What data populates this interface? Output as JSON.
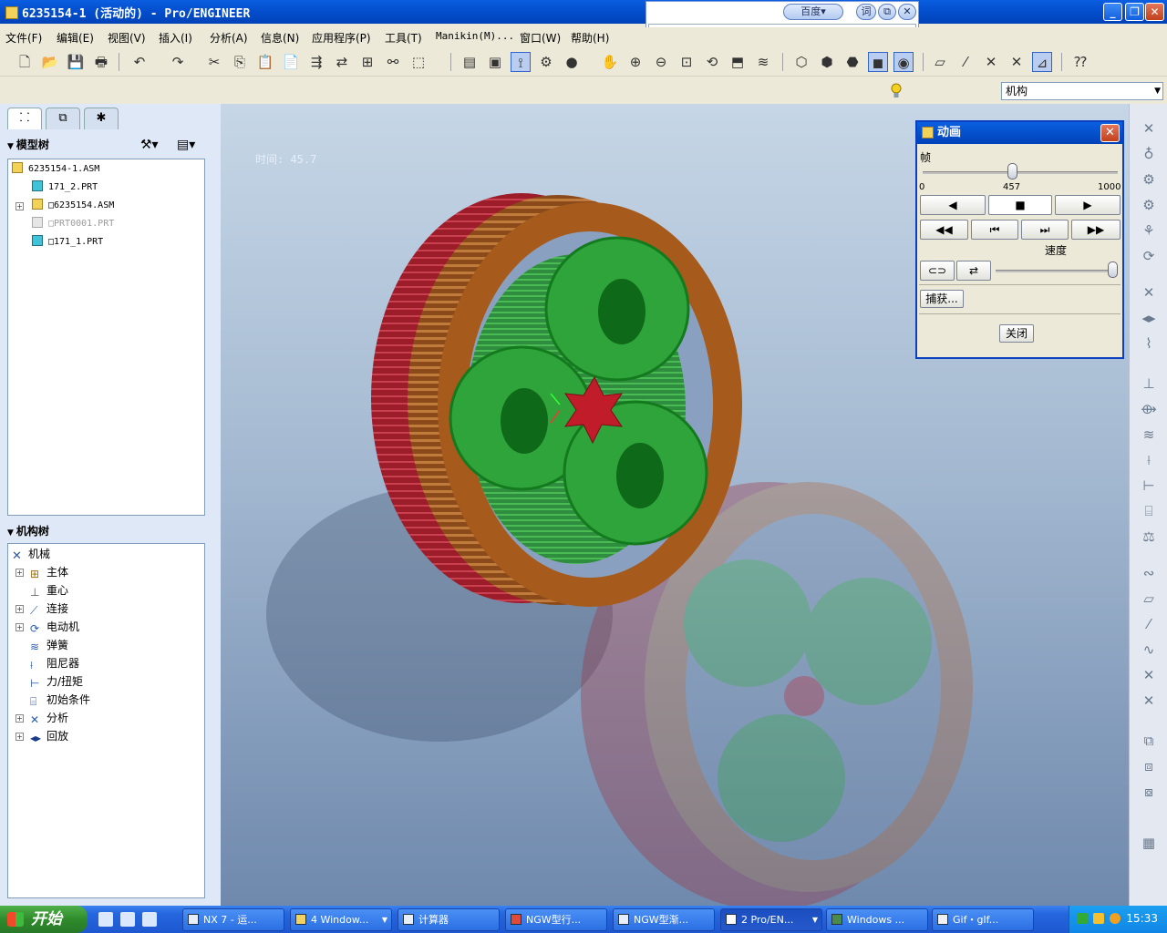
{
  "window": {
    "title": "6235154-1 (活动的) - Pro/ENGINEER"
  },
  "baidu_bar": {
    "search_button": "百度▾",
    "dict_button": "词"
  },
  "menu": [
    "文件(F)",
    "编辑(E)",
    "视图(V)",
    "插入(I)",
    "分析(A)",
    "信息(N)",
    "应用程序(P)",
    "工具(T)",
    "Manikin(M)...",
    "窗口(W)",
    "帮助(H)"
  ],
  "filter_select": {
    "value": "机构"
  },
  "model_tree": {
    "header": "模型树",
    "items": [
      {
        "label": "6235154-1.ASM",
        "color": "#f3d25a"
      },
      {
        "label": "171_2.PRT",
        "color": "#3fc3d8"
      },
      {
        "label": "□6235154.ASM",
        "color": "#f3d25a"
      },
      {
        "label": "□PRT0001.PRT",
        "color": "#cfcfcf"
      },
      {
        "label": "□171_1.PRT",
        "color": "#3fc3d8"
      }
    ]
  },
  "mech_tree": {
    "header": "机构树",
    "root": "机械",
    "items": [
      "主体",
      "重心",
      "连接",
      "电动机",
      "弹簧",
      "阻尼器",
      "力/扭矩",
      "初始条件",
      "分析",
      "回放"
    ]
  },
  "viewport": {
    "time_label": "时间: 45.7"
  },
  "animation_dialog": {
    "title": "动画",
    "frame_label": "帧",
    "slider_min": "0",
    "slider_value": "457",
    "slider_max": "1000",
    "frame_value": 457,
    "frame_max": 1000,
    "speed_label": "速度",
    "capture_button": "捕获...",
    "close_button": "关闭"
  },
  "taskbar": {
    "start_label": "开始",
    "tasks": [
      "NX 7 - 运...",
      "4 Window...",
      "计算器",
      "NGW型行...",
      "NGW型渐...",
      "2 Pro/EN...",
      "Windows ...",
      "Gif・gIf..."
    ],
    "clock": "15:33"
  }
}
